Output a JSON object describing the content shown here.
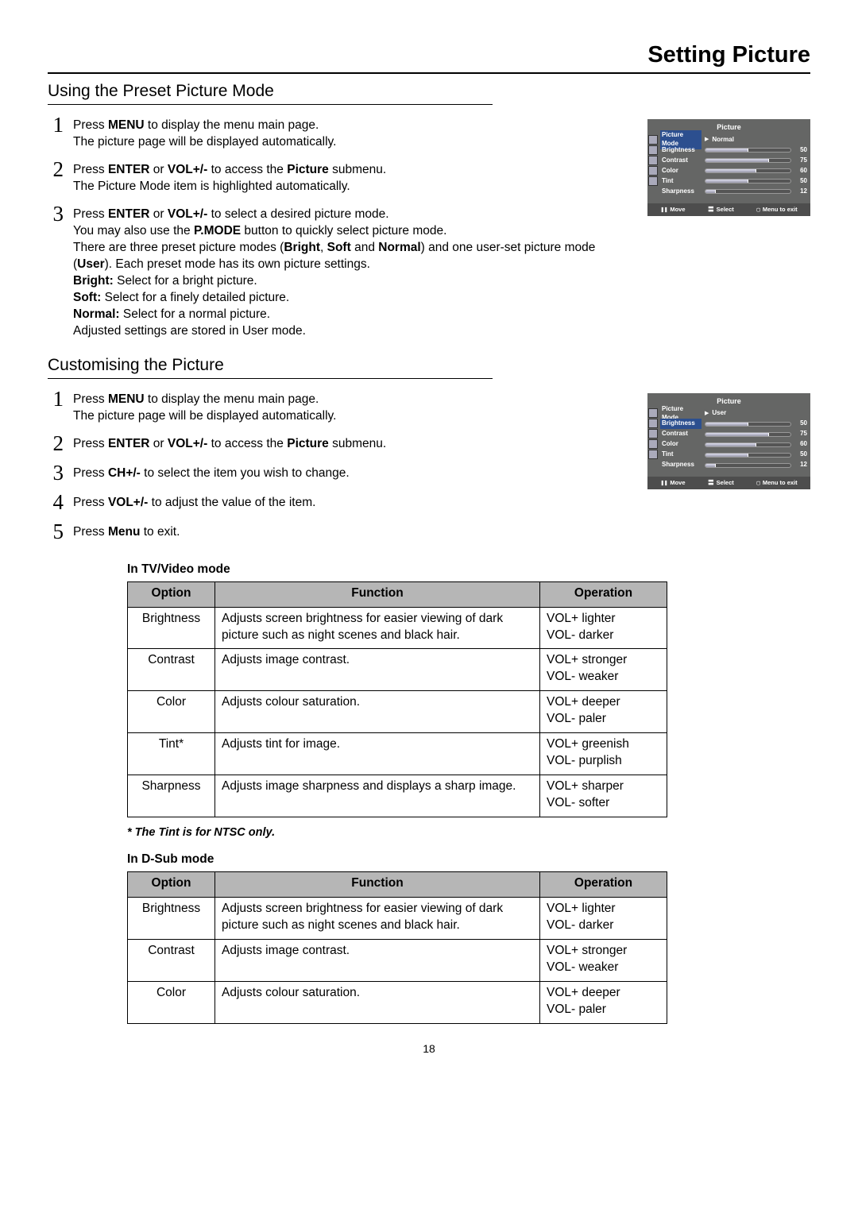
{
  "page_title": "Setting Picture",
  "section1": {
    "heading": "Using the Preset Picture Mode",
    "steps": [
      {
        "n": "1",
        "html": "Press <b>MENU</b> to display the menu main page.<br>The picture page will be displayed automatically."
      },
      {
        "n": "2",
        "html": "Press <b>ENTER</b> or <b>VOL+/-</b> to access the <b>Picture</b> submenu.<br>The Picture Mode item is highlighted automatically."
      },
      {
        "n": "3",
        "html": "Press <b>ENTER</b> or <b>VOL+/-</b> to select a desired picture mode.<br>You may also use the <b>P.MODE</b> button to quickly select picture mode.<br>There are three preset picture modes (<b>Bright</b>, <b>Soft</b> and <b>Normal</b>) and one user-set picture mode (<b>User</b>). Each preset mode has its own picture settings.<br><b>Bright:</b> Select for a bright picture.<br><b>Soft:</b> Select for a finely detailed picture.<br><b>Normal:</b> Select for a normal picture.<br>Adjusted settings are stored in User mode."
      }
    ]
  },
  "section2": {
    "heading": "Customising the Picture",
    "steps": [
      {
        "n": "1",
        "html": "Press <b>MENU</b> to display the menu main page.<br>The picture page will be displayed automatically."
      },
      {
        "n": "2",
        "html": "Press <b>ENTER</b> or <b>VOL+/-</b> to access the <b>Picture</b> submenu."
      },
      {
        "n": "3",
        "html": "Press <b>CH+/-</b> to select the item you wish to change."
      },
      {
        "n": "4",
        "html": "Press <b>VOL+/-</b> to adjust the value of the item."
      },
      {
        "n": "5",
        "html": "Press <b>Menu</b> to exit."
      }
    ]
  },
  "osd": {
    "title": "Picture",
    "footer": {
      "move": "Move",
      "select": "Select",
      "exit": "Menu to exit"
    },
    "labels": {
      "mode": "Picture Mode",
      "bright": "Brightness",
      "contrast": "Contrast",
      "color": "Color",
      "tint": "Tint",
      "sharp": "Sharpness"
    },
    "mode_values": {
      "a": "Normal",
      "b": "User"
    },
    "vals": {
      "bright": 50,
      "contrast": 75,
      "color": 60,
      "tint": 50,
      "sharp": 12
    }
  },
  "tv_mode_label": "In TV/Video mode",
  "table_headers": {
    "opt": "Option",
    "func": "Function",
    "oper": "Operation"
  },
  "tv_rows": [
    {
      "opt": "Brightness",
      "func": "Adjusts screen brightness for easier viewing of dark picture such as night scenes and black hair.",
      "op1": "VOL+ lighter",
      "op2": "VOL- darker"
    },
    {
      "opt": "Contrast",
      "func": "Adjusts image contrast.",
      "op1": "VOL+ stronger",
      "op2": "VOL- weaker"
    },
    {
      "opt": "Color",
      "func": "Adjusts colour saturation.",
      "op1": "VOL+ deeper",
      "op2": "VOL- paler"
    },
    {
      "opt": "Tint*",
      "func": "Adjusts tint for image.",
      "op1": "VOL+ greenish",
      "op2": "VOL- purplish"
    },
    {
      "opt": "Sharpness",
      "func": "Adjusts image sharpness and displays a sharp image.",
      "op1": "VOL+ sharper",
      "op2": "VOL- softer"
    }
  ],
  "tint_note": "* The Tint is for NTSC only.",
  "dsub_label": "In D-Sub mode",
  "dsub_rows": [
    {
      "opt": "Brightness",
      "func": "Adjusts screen brightness for easier viewing of dark picture such as night scenes and black hair.",
      "op1": "VOL+ lighter",
      "op2": "VOL- darker"
    },
    {
      "opt": "Contrast",
      "func": "Adjusts image contrast.",
      "op1": "VOL+ stronger",
      "op2": "VOL- weaker"
    },
    {
      "opt": "Color",
      "func": "Adjusts colour saturation.",
      "op1": "VOL+ deeper",
      "op2": "VOL- paler"
    }
  ],
  "page_number": "18"
}
